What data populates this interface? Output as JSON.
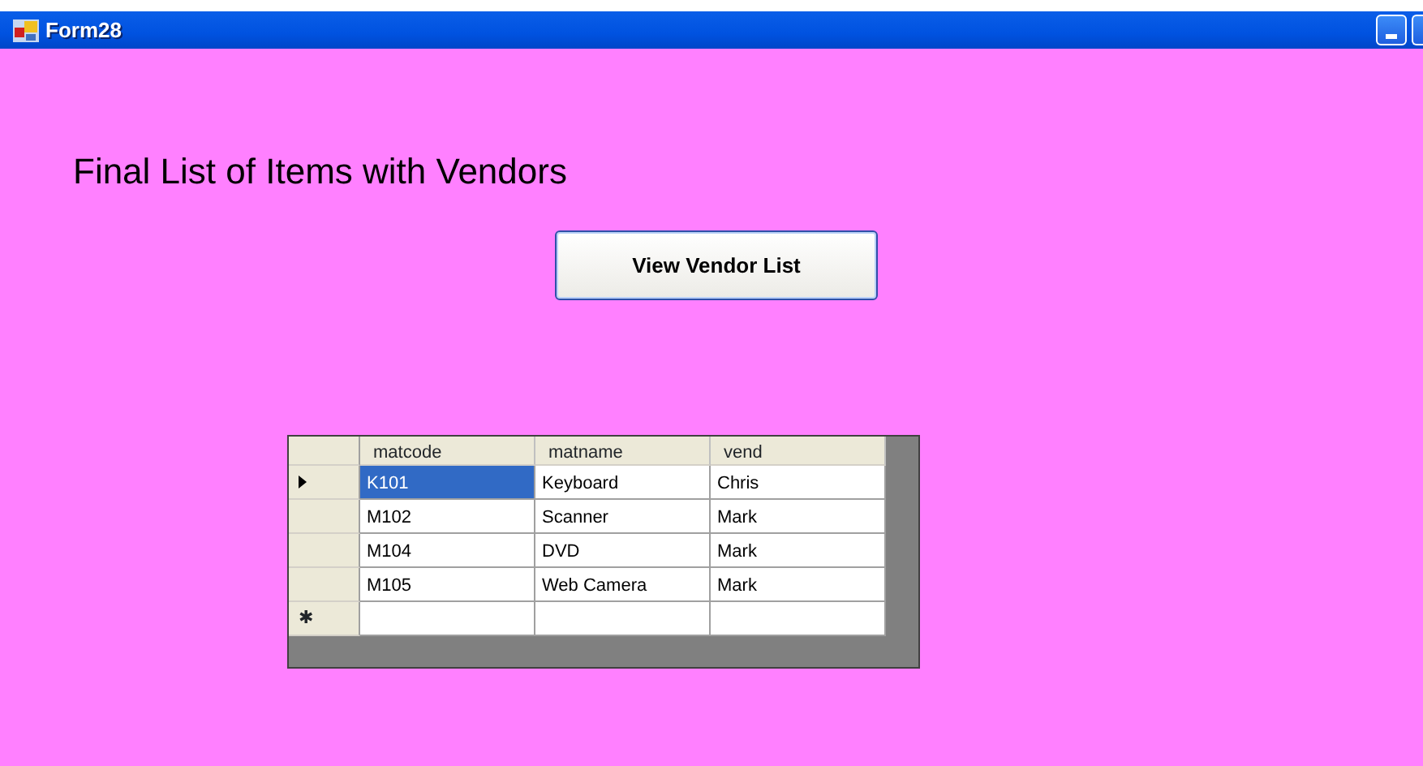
{
  "window": {
    "title": "Form28"
  },
  "heading": "Final List of Items with Vendors",
  "button": "View Vendor List",
  "table": {
    "columns": [
      "matcode",
      "matname",
      "vend"
    ],
    "rows": [
      {
        "current": true,
        "cells": [
          {
            "text": "K101",
            "selected": true
          },
          {
            "text": "Keyboard",
            "selected": false
          },
          {
            "text": "Chris",
            "selected": false
          }
        ]
      },
      {
        "current": false,
        "cells": [
          {
            "text": "M102",
            "selected": false
          },
          {
            "text": "Scanner",
            "selected": false
          },
          {
            "text": "Mark",
            "selected": false
          }
        ]
      },
      {
        "current": false,
        "cells": [
          {
            "text": "M104",
            "selected": false
          },
          {
            "text": "DVD",
            "selected": false
          },
          {
            "text": "Mark",
            "selected": false
          }
        ]
      },
      {
        "current": false,
        "cells": [
          {
            "text": "M105",
            "selected": false
          },
          {
            "text": "Web Camera",
            "selected": false
          },
          {
            "text": "Mark",
            "selected": false
          }
        ]
      }
    ],
    "new_row": {
      "marker": "✱"
    }
  }
}
